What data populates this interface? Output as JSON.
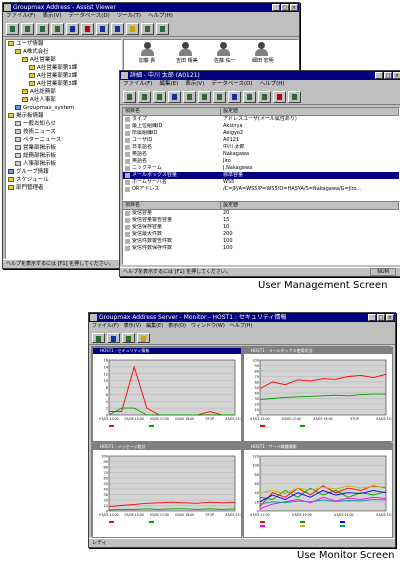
{
  "viewer": {
    "title": "Groupmax Address - Assist Viewer",
    "window_buttons": [
      "_",
      "□",
      "×"
    ],
    "menu": [
      "ファイル(F)",
      "表示(V)",
      "データベース(D)",
      "ツール(T)",
      "ヘルプ(H)"
    ],
    "tree": [
      {
        "label": "ユーザ情報",
        "depth": 0,
        "icon": "folder"
      },
      {
        "label": "A株式会社",
        "depth": 1,
        "icon": "folder"
      },
      {
        "label": "A社営業部",
        "depth": 2,
        "icon": "folder"
      },
      {
        "label": "A社営業部第1課",
        "depth": 3,
        "icon": "folder"
      },
      {
        "label": "A社営業部第2課",
        "depth": 3,
        "icon": "folder"
      },
      {
        "label": "A社営業部第3課",
        "depth": 3,
        "icon": "folder"
      },
      {
        "label": "A社総務部",
        "depth": 2,
        "icon": "folder"
      },
      {
        "label": "A社人事部",
        "depth": 2,
        "icon": "folder"
      },
      {
        "label": "Groupmax_system",
        "depth": 1,
        "icon": "group"
      },
      {
        "label": "掲示板情報",
        "depth": 0,
        "icon": "folder"
      },
      {
        "label": "一般お知らせ",
        "depth": 1,
        "icon": "doc"
      },
      {
        "label": "技術ニュース",
        "depth": 1,
        "icon": "doc"
      },
      {
        "label": "ペターニュース",
        "depth": 1,
        "icon": "doc"
      },
      {
        "label": "営業部掲示板",
        "depth": 1,
        "icon": "doc"
      },
      {
        "label": "総務部掲示板",
        "depth": 1,
        "icon": "doc"
      },
      {
        "label": "人事部掲示板",
        "depth": 1,
        "icon": "doc"
      },
      {
        "label": "グループ情報",
        "depth": 0,
        "icon": "group"
      },
      {
        "label": "スケジュール",
        "depth": 0,
        "icon": "folder"
      },
      {
        "label": "部門管理者",
        "depth": 0,
        "icon": "folder"
      }
    ],
    "users": [
      {
        "name": "加藤 貴"
      },
      {
        "name": "吉田 晴美"
      },
      {
        "name": "佐藤 佑一"
      },
      {
        "name": "細田 宏明"
      }
    ],
    "status": "ヘルプを表示するには [F1] を押してください。"
  },
  "detail": {
    "title": "詳細 - 中川 太郎 (A0121)",
    "menu": [
      "ファイル(F)",
      "編集(E)",
      "表示(V)",
      "データベース(D)",
      "ヘルプ(H)"
    ],
    "columns": [
      "項目名",
      "設定値"
    ],
    "rows": [
      {
        "key": "タイプ",
        "value": "アドレスユーザ(メール属性あり)"
      },
      {
        "key": "最上位組織ID",
        "value": "Aksinya"
      },
      {
        "key": "所属組織ID",
        "value": "Aeigyo2"
      },
      {
        "key": "ユーザID",
        "value": "A0121"
      },
      {
        "key": "日本語名",
        "value": "中川 太郎"
      },
      {
        "key": "英語名",
        "value": "Nakagawa"
      },
      {
        "key": "英語名",
        "value": "Jiro"
      },
      {
        "key": "ニックネーム",
        "value": "J.Nakagawa"
      },
      {
        "key": "メールボックス容量",
        "value": "標準容量",
        "selected": true
      },
      {
        "key": "ホームサーバ名",
        "value": "WS5"
      },
      {
        "key": "ORアドレス",
        "value": "/C=JP/A=WS5/P=WS5/O=HASYA/S=Nakagawa/G=Jiro..."
      }
    ],
    "columns2": [
      "項目名",
      "設定値"
    ],
    "rows2": [
      {
        "key": "受信容量",
        "value": "20"
      },
      {
        "key": "受信容量警告容量",
        "value": "15"
      },
      {
        "key": "受信保存容量",
        "value": "10"
      },
      {
        "key": "受信最大件数",
        "value": "200"
      },
      {
        "key": "受信件数警告件数",
        "value": "100"
      },
      {
        "key": "受信件数保存件数",
        "value": "100"
      }
    ],
    "status": "ヘルプを表示するには [F1] を押してください。",
    "status_right": "NUM"
  },
  "captions": {
    "user_management": "User Management Screen",
    "use_monitor": "Use Monitor Screen"
  },
  "monitor": {
    "title": "Groupmax Address Server - Monitor - HOST1 : セキュリティ情報",
    "menu": [
      "ファイル(F)",
      "表示(V)",
      "編集(E)",
      "表示(D)",
      "ウィンドウ(W)",
      "ヘルプ(H)"
    ],
    "status": "レディ",
    "charts": [
      {
        "title": "HOST1 - セキュリティ情報",
        "active": true
      },
      {
        "title": "HOST1 - メールボックス使用状況",
        "active": false
      },
      {
        "title": "HOST1 - メッセージ統計",
        "active": false
      },
      {
        "title": "HOST1 - サーバ稼働情報",
        "active": false
      }
    ]
  },
  "chart_data": [
    {
      "type": "line",
      "title": "HOST1 - セキュリティ情報",
      "y_ticks": [
        0,
        2,
        4,
        6,
        8,
        10,
        12,
        14,
        16
      ],
      "x": [
        "03/05 13:00",
        "03/05 15:00",
        "03/05 17:00",
        "03/05 19:00",
        "STOP",
        "03/05 23:00"
      ],
      "ylim": [
        0,
        16
      ],
      "series": [
        {
          "color": "#ff0000",
          "values": [
            1,
            1,
            14,
            2,
            0,
            0,
            0,
            0,
            1,
            0,
            0
          ]
        },
        {
          "color": "#00a000",
          "values": [
            0,
            2,
            2,
            0,
            0,
            0,
            0,
            0,
            0,
            0,
            0
          ]
        }
      ]
    },
    {
      "type": "line",
      "title": "HOST1 - メールボックス使用状況",
      "y_ticks": [
        0,
        10,
        20,
        30,
        40,
        50,
        60,
        70,
        80,
        90,
        100
      ],
      "x": [
        "03/05 15:00",
        "03/05 17:00",
        "03/05 19:00",
        "STOP",
        "03/05 23:00"
      ],
      "ylim": [
        0,
        100
      ],
      "series": [
        {
          "color": "#ff0000",
          "values": [
            48,
            60,
            55,
            64,
            62,
            66,
            65,
            70,
            72,
            68,
            74
          ]
        },
        {
          "color": "#00a000",
          "values": [
            28,
            30,
            32,
            33,
            34,
            35,
            36,
            35,
            37,
            38,
            38
          ]
        }
      ]
    },
    {
      "type": "line",
      "title": "HOST1 - メッセージ統計",
      "y_ticks": [
        0,
        10,
        20,
        30,
        40,
        50,
        60,
        70,
        80,
        90,
        100
      ],
      "x": [
        "03/05 13:00",
        "03/05 15:00",
        "03/05 17:00",
        "03/05 19:00",
        "STOP",
        "03/05 23:00"
      ],
      "ylim": [
        0,
        100
      ],
      "series": [
        {
          "color": "#ff0000",
          "values": [
            8,
            10,
            12,
            14,
            15,
            16,
            15,
            14,
            16,
            15,
            16
          ]
        },
        {
          "color": "#00a000",
          "values": [
            2,
            3,
            3,
            4,
            3,
            4,
            4,
            3,
            4,
            3,
            4
          ]
        }
      ]
    },
    {
      "type": "line",
      "title": "HOST1 - サーバ稼働情報",
      "y_ticks": [
        0,
        20,
        40,
        60,
        80,
        100,
        120
      ],
      "x": [
        "03/05 17:00",
        "03/05 19:00",
        "03/05 21:00",
        "03/05 23:00"
      ],
      "ylim": [
        0,
        120
      ],
      "series": [
        {
          "color": "#ff0000",
          "values": [
            10,
            40,
            30,
            50,
            35,
            55,
            40,
            50,
            45,
            55,
            50
          ]
        },
        {
          "color": "#00a000",
          "values": [
            30,
            25,
            45,
            30,
            50,
            35,
            45,
            30,
            40,
            35,
            42
          ]
        },
        {
          "color": "#0000ff",
          "values": [
            20,
            35,
            25,
            40,
            30,
            45,
            35,
            40,
            38,
            45,
            40
          ]
        },
        {
          "color": "#ff00ff",
          "values": [
            5,
            15,
            20,
            25,
            18,
            30,
            22,
            28,
            25,
            30,
            27
          ]
        },
        {
          "color": "#c0c000",
          "values": [
            40,
            45,
            38,
            50,
            46,
            52,
            48,
            55,
            50,
            53,
            52
          ]
        },
        {
          "color": "#00a0a0",
          "values": [
            15,
            20,
            18,
            22,
            20,
            24,
            21,
            23,
            22,
            25,
            24
          ]
        }
      ]
    }
  ]
}
